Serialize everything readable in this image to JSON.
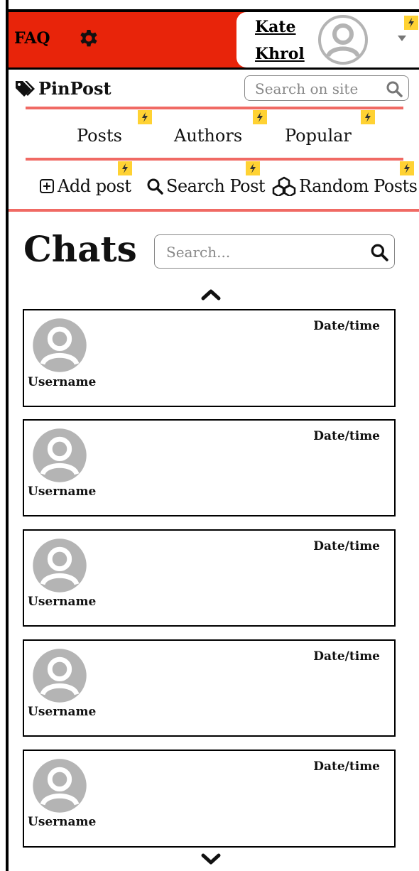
{
  "header": {
    "faq_label": "FAQ",
    "user_name": "Kate Khrol",
    "accent_color": "#e8240a",
    "badge_color": "#ffd233"
  },
  "site": {
    "brand": "PinPost",
    "search_placeholder": "Search on site"
  },
  "nav": {
    "items": [
      {
        "label": "Posts"
      },
      {
        "label": "Authors"
      },
      {
        "label": "Popular"
      }
    ]
  },
  "actions": {
    "add_post": "Add post",
    "search_post": "Search Post",
    "random_posts": "Random Posts"
  },
  "chats": {
    "title": "Chats",
    "search_placeholder": "Search...",
    "items": [
      {
        "username": "Username",
        "datetime": "Date/time"
      },
      {
        "username": "Username",
        "datetime": "Date/time"
      },
      {
        "username": "Username",
        "datetime": "Date/time"
      },
      {
        "username": "Username",
        "datetime": "Date/time"
      },
      {
        "username": "Username",
        "datetime": "Date/time"
      }
    ]
  },
  "icons": [
    "gear-icon",
    "avatar-icon",
    "dropdown-caret-icon",
    "lightning-icon",
    "tags-icon",
    "search-icon",
    "plus-square-icon",
    "cubes-icon",
    "chevron-up-icon",
    "chevron-down-icon"
  ]
}
